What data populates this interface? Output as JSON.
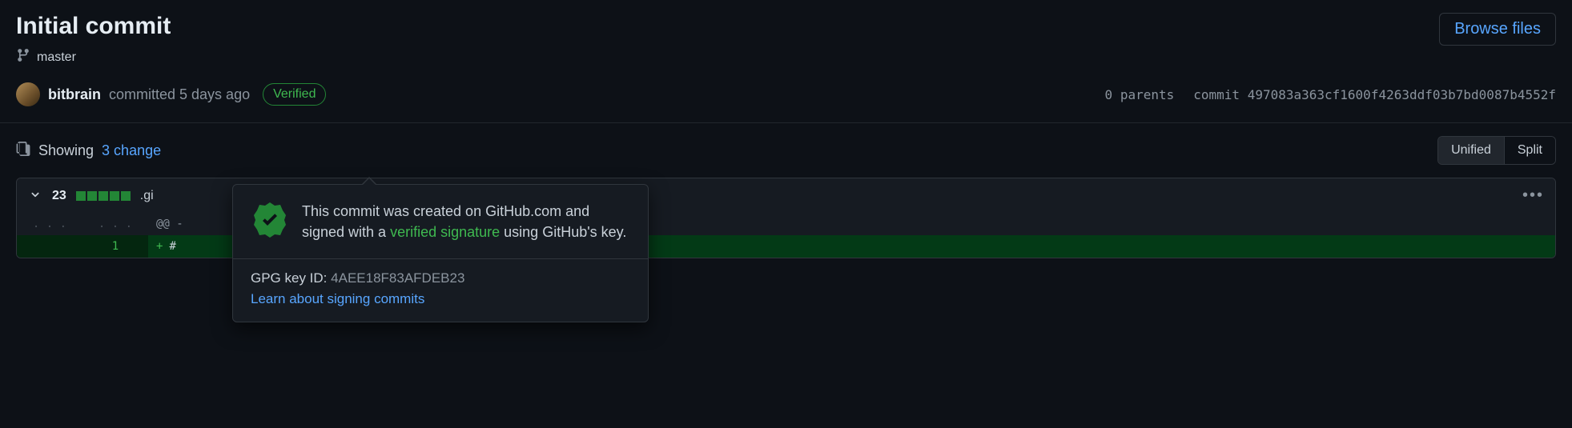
{
  "commit": {
    "title": "Initial commit",
    "branch": "master",
    "author": "bitbrain",
    "committed_text": "committed 5 days ago",
    "verified_label": "Verified",
    "parents_text": "0 parents",
    "commit_label": "commit",
    "sha": "497083a363cf1600f4263ddf03b7bd0087b4552f"
  },
  "browse_files_label": "Browse files",
  "diff_summary": {
    "showing_prefix": "Showing",
    "changed_files_link": "3 change",
    "trailing_punct": "."
  },
  "view_toggle": {
    "unified": "Unified",
    "split": "Split"
  },
  "file": {
    "change_count": "23",
    "name": ".gi",
    "hunk_header": "@@ -",
    "first_line_num": "1",
    "first_line_prefix": "+",
    "first_line_code": "#"
  },
  "popover": {
    "text_prefix": "This commit was created on GitHub.com and signed with a ",
    "verified_signature": "verified signature",
    "text_suffix": " using GitHub's key.",
    "gpg_label": "GPG key ID:",
    "gpg_id": "4AEE18F83AFDEB23",
    "learn_link": "Learn about signing commits"
  }
}
